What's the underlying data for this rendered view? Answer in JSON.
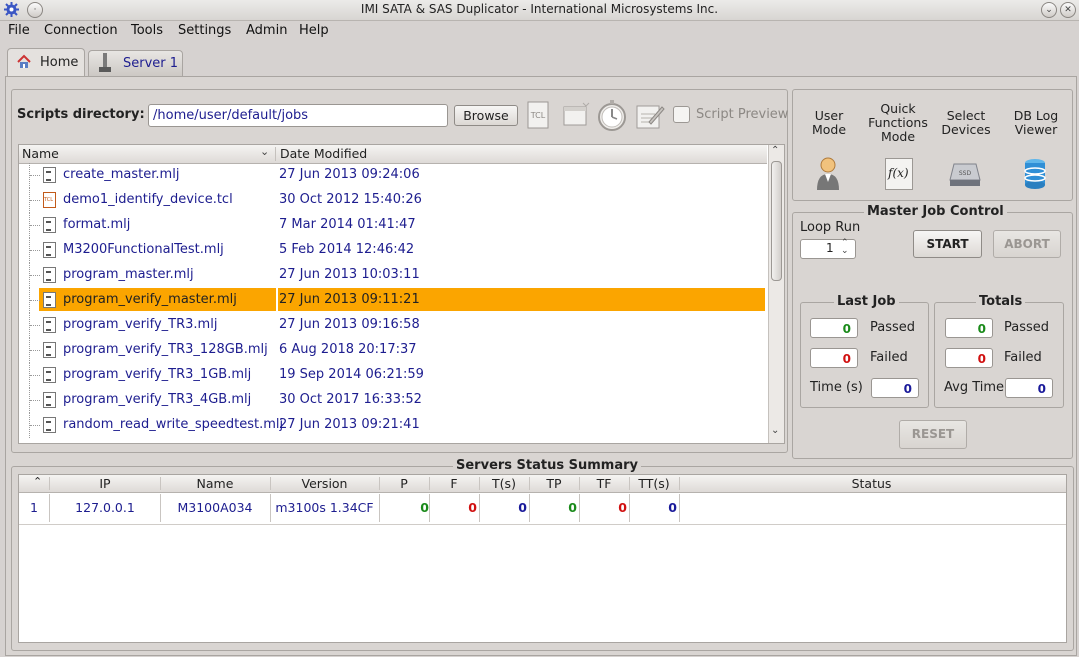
{
  "window": {
    "title": "IMI SATA & SAS Duplicator - International Microsystems Inc."
  },
  "menu": [
    "File",
    "Connection",
    "Tools",
    "Settings",
    "Admin",
    "Help"
  ],
  "tabs": [
    {
      "label": "Home"
    },
    {
      "label": "Server 1"
    }
  ],
  "scripts": {
    "label": "Scripts directory:",
    "path": "/home/user/default/jobs",
    "browse": "Browse",
    "preview_label": "Script Preview",
    "col_name": "Name",
    "col_date": "Date Modified",
    "files": [
      {
        "name": "create_master.mlj",
        "date": "27 Jun 2013 09:24:06",
        "type": "mlj"
      },
      {
        "name": "demo1_identify_device.tcl",
        "date": "30 Oct 2012 15:40:26",
        "type": "tcl"
      },
      {
        "name": "format.mlj",
        "date": "7 Mar 2014 01:41:47",
        "type": "mlj"
      },
      {
        "name": "M3200FunctionalTest.mlj",
        "date": "5 Feb 2014 12:46:42",
        "type": "mlj"
      },
      {
        "name": "program_master.mlj",
        "date": "27 Jun 2013 10:03:11",
        "type": "mlj"
      },
      {
        "name": "program_verify_master.mlj",
        "date": "27 Jun 2013 09:11:21",
        "type": "mlj",
        "selected": true
      },
      {
        "name": "program_verify_TR3.mlj",
        "date": "27 Jun 2013 09:16:58",
        "type": "mlj"
      },
      {
        "name": "program_verify_TR3_128GB.mlj",
        "date": "6 Aug 2018 20:17:37",
        "type": "mlj"
      },
      {
        "name": "program_verify_TR3_1GB.mlj",
        "date": "19 Sep 2014 06:21:59",
        "type": "mlj"
      },
      {
        "name": "program_verify_TR3_4GB.mlj",
        "date": "30 Oct 2017 16:33:52",
        "type": "mlj"
      },
      {
        "name": "random_read_write_speedtest.mlj",
        "date": "27 Jun 2013 09:21:41",
        "type": "mlj"
      }
    ]
  },
  "modes": {
    "user_mode": "User Mode",
    "quick_functions": "Quick Functions Mode",
    "select_devices": "Select Devices",
    "db_log_viewer": "DB Log Viewer"
  },
  "job_control": {
    "title": "Master Job Control",
    "loop_run_label": "Loop Run",
    "loop_run_value": "1",
    "start": "START",
    "abort": "ABORT",
    "reset": "RESET",
    "last_job": {
      "title": "Last Job",
      "passed_label": "Passed",
      "passed": "0",
      "failed_label": "Failed",
      "failed": "0",
      "time_label": "Time (s)",
      "time": "0"
    },
    "totals": {
      "title": "Totals",
      "passed_label": "Passed",
      "passed": "0",
      "failed_label": "Failed",
      "failed": "0",
      "avg_label": "Avg Time",
      "avg": "0"
    }
  },
  "servers": {
    "title": "Servers Status Summary",
    "columns": [
      "IP",
      "Name",
      "Version",
      "P",
      "F",
      "T(s)",
      "TP",
      "TF",
      "TT(s)",
      "Status"
    ],
    "rows": [
      {
        "index": "1",
        "ip": "127.0.0.1",
        "name": "M3100A034",
        "version": "m3100s 1.34CF",
        "p": "0",
        "f": "0",
        "t": "0",
        "tp": "0",
        "tf": "0",
        "tt": "0",
        "status": ""
      }
    ]
  },
  "colors": {
    "selection": "#fba500",
    "link_text": "#1d1d8f",
    "pass": "#1a8a1a",
    "fail": "#d01010",
    "time": "#1a1a9a"
  }
}
